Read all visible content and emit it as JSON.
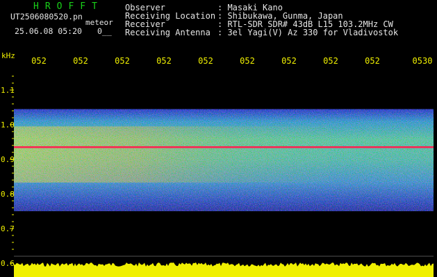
{
  "header": {
    "app_title": "HROFFT",
    "file_name": "UT2506080520.pn",
    "mode_label": "meteor",
    "date_time": "25.06.08 05:20",
    "counter": "0__"
  },
  "station_info": {
    "labels": [
      "Observer",
      "Receiving Location",
      "Receiver",
      "Receiving Antenna"
    ],
    "values": [
      ": Masaki Kano",
      ": Shibukawa, Gunma, Japan",
      ": RTL-SDR SDR# 43dB L15 103.2MHz CW",
      ": 3el Yagi(V) Az 330 for Vladivostok"
    ]
  },
  "colors": {
    "title": "#19d219",
    "text": "#e6e6e6",
    "axis": "#f0f000",
    "background": "#000000",
    "carrier": "#ff2050"
  },
  "chart_data": {
    "type": "heatmap",
    "title": "",
    "ylabel": "kHz",
    "xlabel": "",
    "x_tick_labels": [
      "052",
      "052",
      "052",
      "052",
      "052",
      "052",
      "052",
      "052",
      "052",
      "0530"
    ],
    "y_ticks": [
      1.1,
      1.0,
      0.9,
      0.8,
      0.7,
      0.6
    ],
    "y_tick_labels": [
      "1.1",
      "1.0",
      "0.9",
      "0.8",
      "0.7",
      "0.6"
    ],
    "ylim": [
      0.6,
      1.1
    ],
    "grid": false,
    "noise_band_khz": [
      0.75,
      1.045
    ],
    "carrier_line_khz": 0.935,
    "signal_strength_bar": "yellow, bottom"
  }
}
